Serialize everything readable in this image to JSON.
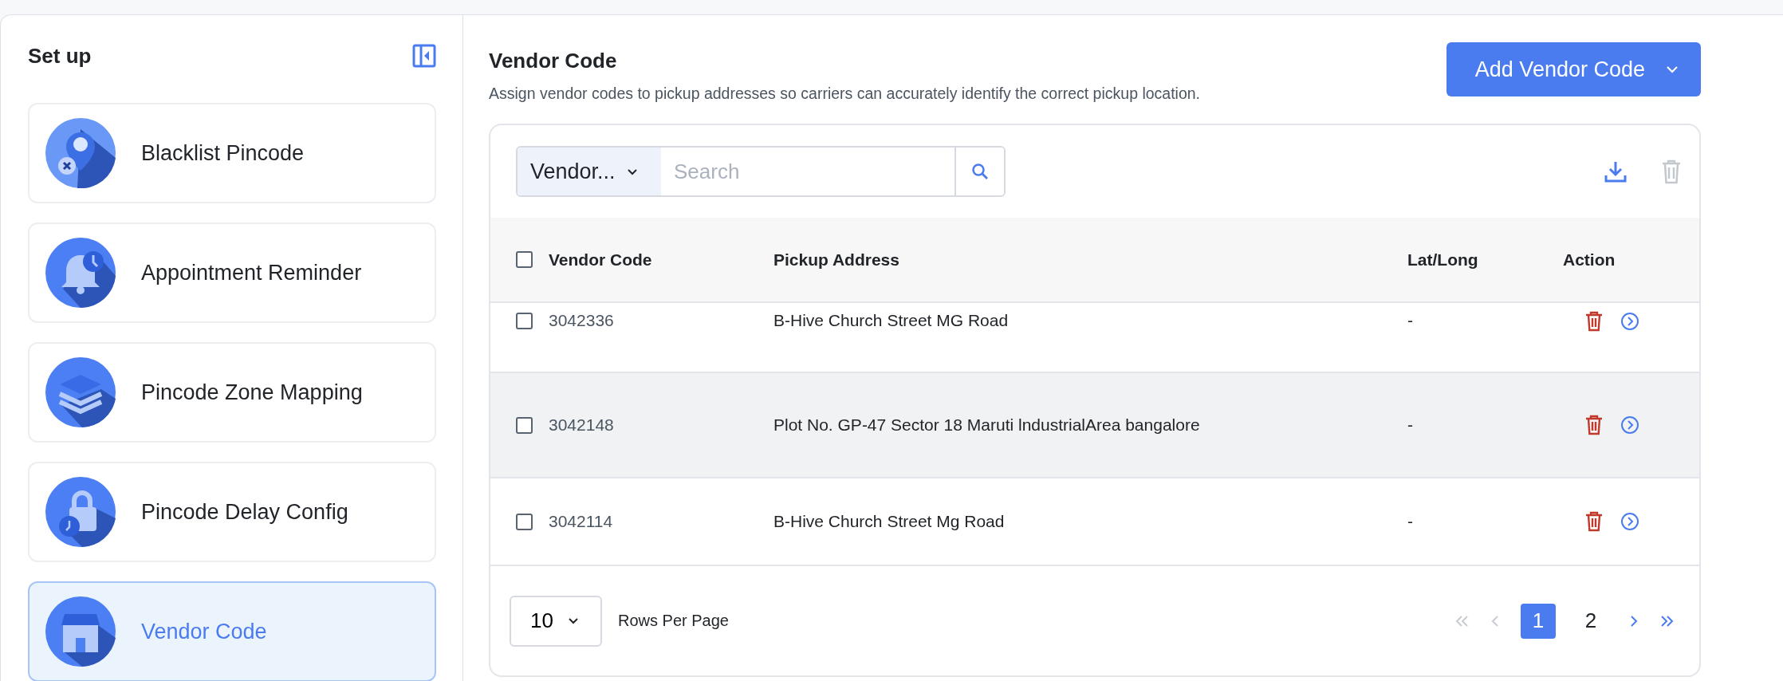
{
  "sidebar": {
    "title": "Set up",
    "items": [
      {
        "label": "Blacklist Pincode",
        "selected": false
      },
      {
        "label": "Appointment Reminder",
        "selected": false
      },
      {
        "label": "Pincode Zone Mapping",
        "selected": false
      },
      {
        "label": "Pincode Delay Config",
        "selected": false
      },
      {
        "label": "Vendor Code",
        "selected": true
      }
    ]
  },
  "header": {
    "title": "Vendor Code",
    "description": "Assign vendor codes to pickup addresses so carriers can accurately identify the correct pickup location.",
    "button": "Add Vendor Code"
  },
  "toolbar": {
    "filter": "Vendor...",
    "search": {
      "placeholder": "Search"
    },
    "delete_disabled": true
  },
  "table": {
    "select_all": {
      "checked": false
    },
    "columns": [
      "Vendor Code",
      "Pickup Address",
      "Lat/Long",
      "Action"
    ],
    "rows": [
      {
        "vendor_code": "3042336",
        "pickup_address": "B-Hive Church Street MG Road",
        "lat_long": "-",
        "checked": false,
        "hovered": false
      },
      {
        "vendor_code": "3042148",
        "pickup_address": "Plot No. GP-47 Sector 18 Maruti lndustrialArea bangalore",
        "lat_long": "-",
        "checked": false,
        "hovered": true
      },
      {
        "vendor_code": "3042114",
        "pickup_address": "B-Hive Church Street Mg Road",
        "lat_long": "-",
        "checked": false,
        "hovered": false
      }
    ]
  },
  "pagination": {
    "rows_per_page": "10",
    "rows_label": "Rows Per Page",
    "first_disabled": true,
    "prev_disabled": true,
    "next_disabled": false,
    "last_disabled": false,
    "pages": [
      {
        "label": "1",
        "selected": true
      },
      {
        "label": "2",
        "selected": false
      }
    ]
  }
}
